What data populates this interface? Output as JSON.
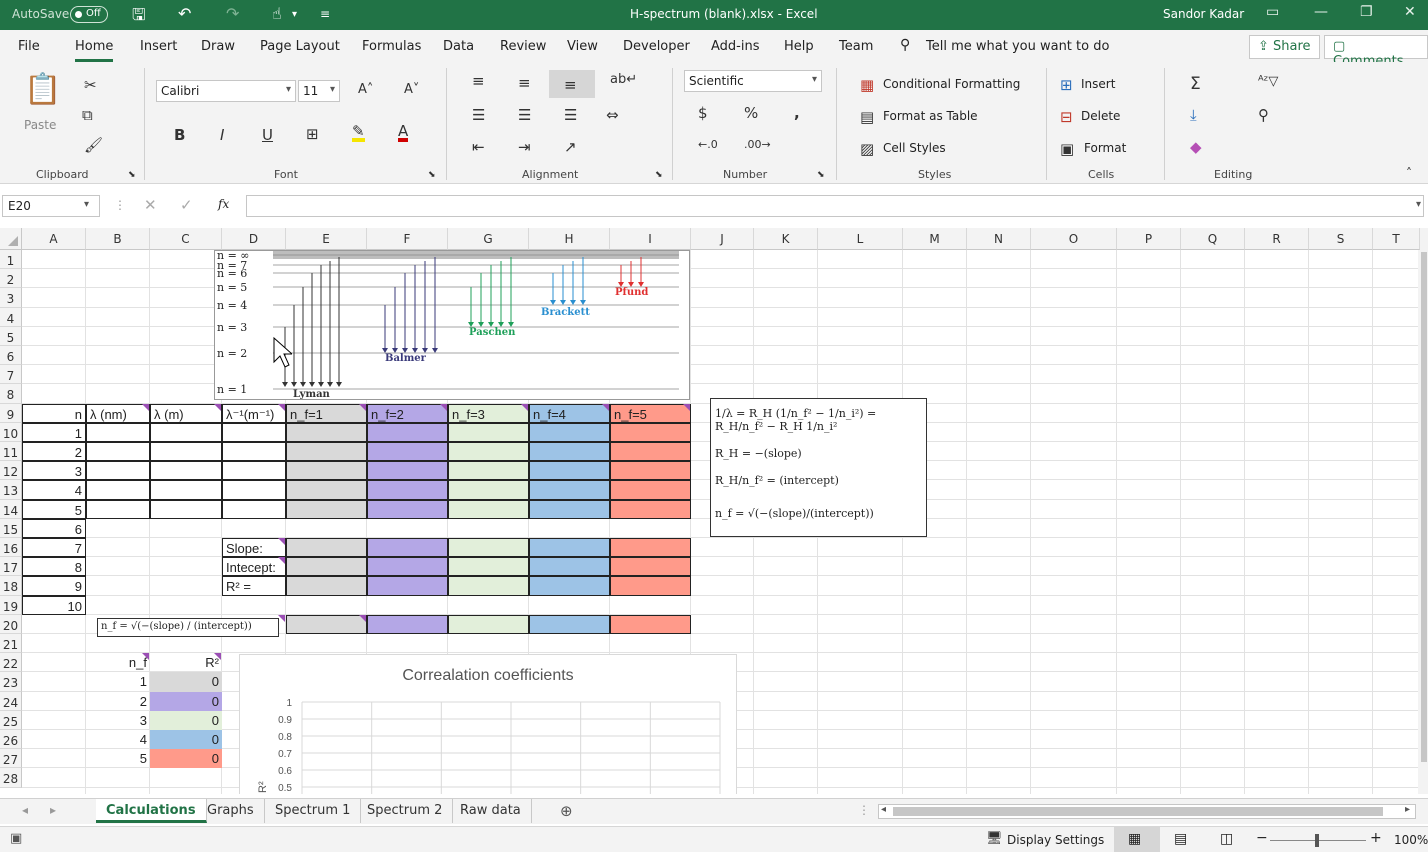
{
  "titlebar": {
    "autosave_label": "AutoSave",
    "autosave_state": "Off",
    "title": "H-spectrum (blank).xlsx  -  Excel",
    "user": "Sandor Kadar"
  },
  "menu": {
    "items": [
      "File",
      "Home",
      "Insert",
      "Draw",
      "Page Layout",
      "Formulas",
      "Data",
      "Review",
      "View",
      "Developer",
      "Add-ins",
      "Help",
      "Team"
    ],
    "active": "Home",
    "tell_me": "Tell me what you want to do",
    "share": "Share",
    "comments": "Comments"
  },
  "ribbon": {
    "clipboard": {
      "label": "Clipboard",
      "paste": "Paste"
    },
    "font": {
      "label": "Font",
      "name": "Calibri",
      "size": "11"
    },
    "alignment": {
      "label": "Alignment"
    },
    "number": {
      "label": "Number",
      "format": "Scientific"
    },
    "styles": {
      "label": "Styles",
      "cond": "Conditional Formatting",
      "table": "Format as Table",
      "cellstyles": "Cell Styles"
    },
    "cells": {
      "label": "Cells",
      "insert": "Insert",
      "delete": "Delete",
      "format": "Format"
    },
    "editing": {
      "label": "Editing"
    }
  },
  "formula_bar": {
    "namebox": "E20",
    "fx": "fx"
  },
  "grid": {
    "columns": [
      "A",
      "B",
      "C",
      "D",
      "E",
      "F",
      "G",
      "H",
      "I",
      "J",
      "K",
      "L",
      "M",
      "N",
      "O",
      "P",
      "Q",
      "R",
      "S",
      "T"
    ],
    "rows": [
      "1",
      "2",
      "3",
      "4",
      "5",
      "6",
      "7",
      "8",
      "9",
      "10",
      "11",
      "12",
      "13",
      "14",
      "15",
      "16",
      "17",
      "18",
      "19",
      "20",
      "21",
      "22",
      "23",
      "24",
      "25",
      "26",
      "27",
      "28"
    ],
    "header_row": {
      "n": "n",
      "lambda_nm": "λ (nm)",
      "lambda_m": "λ (m)",
      "inv_lambda": "λ⁻¹(m⁻¹)",
      "nf1": "n_f=1",
      "nf2": "n_f=2",
      "nf3": "n_f=3",
      "nf4": "n_f=4",
      "nf5": "n_f=5"
    },
    "n_values": [
      "1",
      "2",
      "3",
      "4",
      "5",
      "6",
      "7",
      "8",
      "9",
      "10"
    ],
    "slope_label": "Slope:",
    "intercept_label": "Intecept:",
    "r2_label": "R² =",
    "nf_formula": "n_f = √(−(slope) / (intercept))",
    "lower_table": {
      "header_nf": "n_f",
      "header_r2": "R²",
      "nf": [
        "1",
        "2",
        "3",
        "4",
        "5"
      ],
      "r2": [
        "0",
        "0",
        "0",
        "0",
        "0"
      ]
    }
  },
  "spectrum": {
    "levels": [
      "n = ∞",
      "n = 7",
      "n = 6",
      "n = 5",
      "n = 4",
      "n = 3",
      "n = 2",
      "n = 1"
    ],
    "series": [
      {
        "name": "Lyman",
        "color": "#333333"
      },
      {
        "name": "Balmer",
        "color": "#3a3a7a"
      },
      {
        "name": "Paschen",
        "color": "#1fa05a"
      },
      {
        "name": "Brackett",
        "color": "#2a8fd0"
      },
      {
        "name": "Pfund",
        "color": "#e03030"
      }
    ]
  },
  "equations": {
    "line1": "1/λ = R_H (1/n_f² − 1/n_i²) = R_H/n_f² − R_H 1/n_i²",
    "line2": "R_H = −(slope)",
    "line3": "R_H/n_f² = (intercept)",
    "line4": "n_f = √(−(slope)/(intercept))"
  },
  "chart_data": {
    "type": "line",
    "title": "Correalation coefficients",
    "xlabel": "",
    "ylabel": "R²",
    "y_ticks": [
      "1",
      "0.9",
      "0.8",
      "0.7",
      "0.6",
      "0.5"
    ],
    "ylim": [
      0.5,
      1
    ],
    "grid": true
  },
  "colors": {
    "nf1": "#d9d9d9",
    "nf2": "#b4a7e6",
    "nf3": "#e2efda",
    "nf4": "#9dc3e6",
    "nf5": "#ff9a8a",
    "accent": "#217346"
  },
  "sheets": {
    "tabs": [
      "Calculations",
      "Graphs",
      "Spectrum 1",
      "Spectrum 2",
      "Raw data"
    ],
    "active": "Calculations"
  },
  "status": {
    "display_settings": "Display Settings",
    "zoom": "100%"
  }
}
